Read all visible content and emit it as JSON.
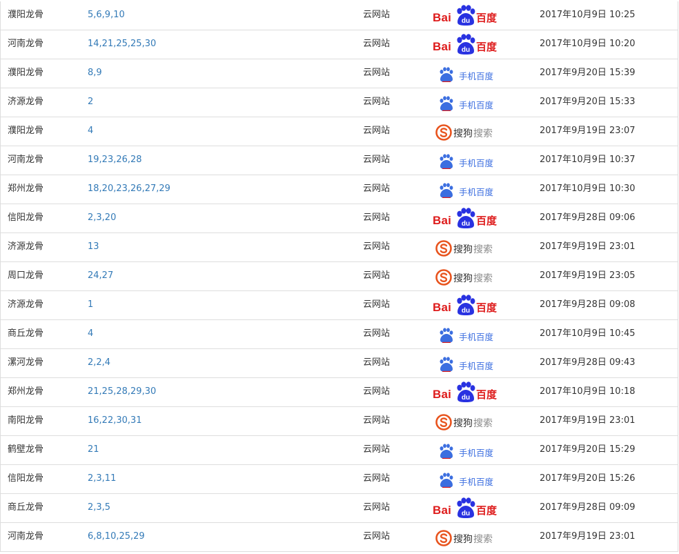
{
  "colors": {
    "link": "#337ab7",
    "baidu_red": "#de1b1b",
    "baidu_blue": "#3b6ee0",
    "sogou_orange": "#e8541e",
    "border": "#dddddd"
  },
  "engines": {
    "baidu": {
      "icon": "baidu-logo",
      "label_left": "Bai",
      "label_mid": "du",
      "label_right": "百度"
    },
    "mbaidu": {
      "icon": "baidu-mobile-logo",
      "label": "手机百度"
    },
    "sogou": {
      "icon": "sogou-logo",
      "label_left": "搜狗",
      "label_right": "搜索"
    }
  },
  "rows": [
    {
      "keyword": "濮阳龙骨",
      "ranks": "5,6,9,10",
      "site": "云网站",
      "engine": "baidu",
      "time": "2017年10月9日 10:25"
    },
    {
      "keyword": "河南龙骨",
      "ranks": "14,21,25,25,30",
      "site": "云网站",
      "engine": "baidu",
      "time": "2017年10月9日 10:20"
    },
    {
      "keyword": "濮阳龙骨",
      "ranks": "8,9",
      "site": "云网站",
      "engine": "mbaidu",
      "time": "2017年9月20日 15:39"
    },
    {
      "keyword": "济源龙骨",
      "ranks": "2",
      "site": "云网站",
      "engine": "mbaidu",
      "time": "2017年9月20日 15:33"
    },
    {
      "keyword": "濮阳龙骨",
      "ranks": "4",
      "site": "云网站",
      "engine": "sogou",
      "time": "2017年9月19日 23:07"
    },
    {
      "keyword": "河南龙骨",
      "ranks": "19,23,26,28",
      "site": "云网站",
      "engine": "mbaidu",
      "time": "2017年10月9日 10:37"
    },
    {
      "keyword": "郑州龙骨",
      "ranks": "18,20,23,26,27,29",
      "site": "云网站",
      "engine": "mbaidu",
      "time": "2017年10月9日 10:30"
    },
    {
      "keyword": "信阳龙骨",
      "ranks": "2,3,20",
      "site": "云网站",
      "engine": "baidu",
      "time": "2017年9月28日 09:06"
    },
    {
      "keyword": "济源龙骨",
      "ranks": "13",
      "site": "云网站",
      "engine": "sogou",
      "time": "2017年9月19日 23:01"
    },
    {
      "keyword": "周口龙骨",
      "ranks": "24,27",
      "site": "云网站",
      "engine": "sogou",
      "time": "2017年9月19日 23:05"
    },
    {
      "keyword": "济源龙骨",
      "ranks": "1",
      "site": "云网站",
      "engine": "baidu",
      "time": "2017年9月28日 09:08"
    },
    {
      "keyword": "商丘龙骨",
      "ranks": "4",
      "site": "云网站",
      "engine": "mbaidu",
      "time": "2017年10月9日 10:45"
    },
    {
      "keyword": "漯河龙骨",
      "ranks": "2,2,4",
      "site": "云网站",
      "engine": "mbaidu",
      "time": "2017年9月28日 09:43"
    },
    {
      "keyword": "郑州龙骨",
      "ranks": "21,25,28,29,30",
      "site": "云网站",
      "engine": "baidu",
      "time": "2017年10月9日 10:18"
    },
    {
      "keyword": "南阳龙骨",
      "ranks": "16,22,30,31",
      "site": "云网站",
      "engine": "sogou",
      "time": "2017年9月19日 23:01"
    },
    {
      "keyword": "鹤壁龙骨",
      "ranks": "21",
      "site": "云网站",
      "engine": "mbaidu",
      "time": "2017年9月20日 15:29"
    },
    {
      "keyword": "信阳龙骨",
      "ranks": "2,3,11",
      "site": "云网站",
      "engine": "mbaidu",
      "time": "2017年9月20日 15:26"
    },
    {
      "keyword": "商丘龙骨",
      "ranks": "2,3,5",
      "site": "云网站",
      "engine": "baidu",
      "time": "2017年9月28日 09:09"
    },
    {
      "keyword": "河南龙骨",
      "ranks": "6,8,10,25,29",
      "site": "云网站",
      "engine": "sogou",
      "time": "2017年9月19日 23:01"
    }
  ]
}
